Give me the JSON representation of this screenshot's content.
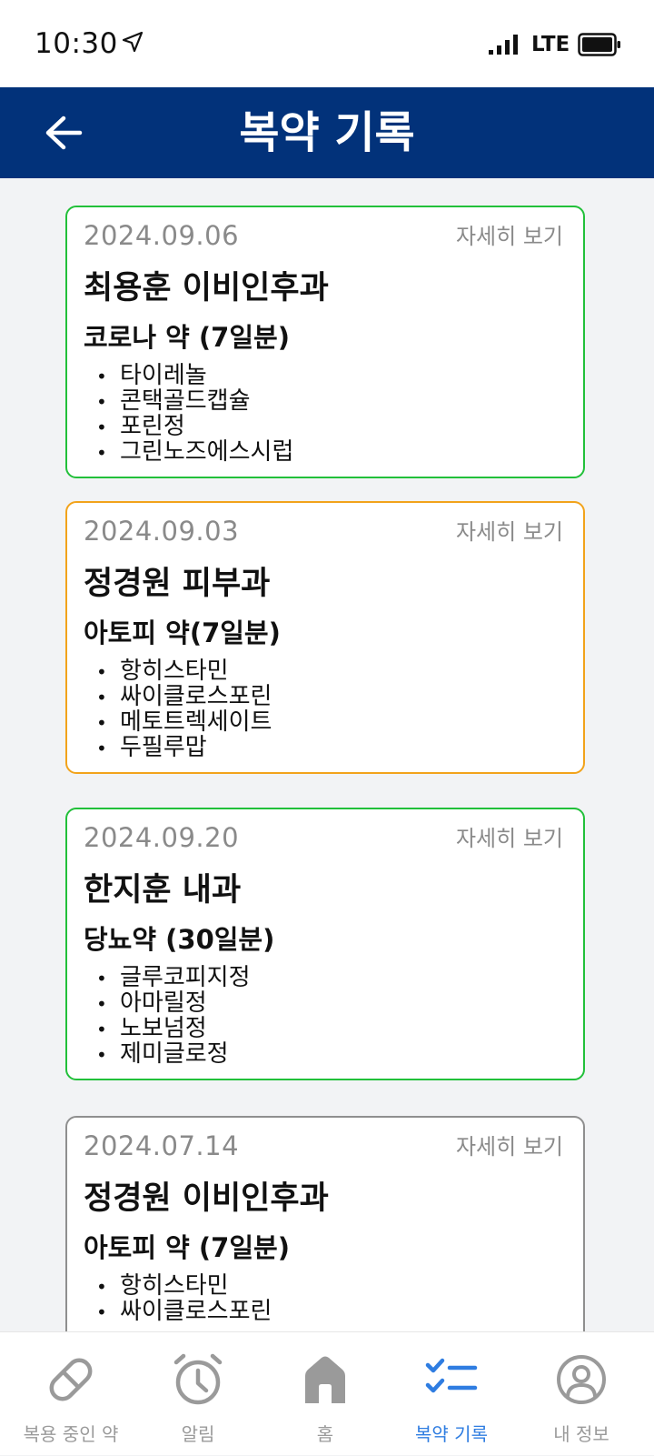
{
  "status_bar": {
    "time": "10:30",
    "network": "LTE"
  },
  "header": {
    "title": "복약 기록"
  },
  "records": [
    {
      "date": "2024.09.06",
      "detail_label": "자세히 보기",
      "clinic": "최용훈 이비인후과",
      "prescription": "코로나 약 (7일분)",
      "medicines": [
        "타이레놀",
        "콘택골드캡슐",
        "포린정",
        "그린노즈에스시럽"
      ],
      "border_color": "#22c03a"
    },
    {
      "date": "2024.09.03",
      "detail_label": "자세히 보기",
      "clinic": "정경원 피부과",
      "prescription": "아토피 약(7일분)",
      "medicines": [
        "항히스타민",
        "싸이클로스포린",
        "메토트렉세이트",
        "두필루맙"
      ],
      "border_color": "#f2a31b"
    },
    {
      "date": "2024.09.20",
      "detail_label": "자세히 보기",
      "clinic": "한지훈 내과",
      "prescription": "당뇨약 (30일분)",
      "medicines": [
        "글루코피지정",
        "아마릴정",
        "노보넘정",
        "제미글로정"
      ],
      "border_color": "#22c03a"
    },
    {
      "date": "2024.07.14",
      "detail_label": "자세히 보기",
      "clinic": "정경원 이비인후과",
      "prescription": "아토피 약 (7일분)",
      "medicines": [
        "항히스타민",
        "싸이클로스포린"
      ],
      "border_color": "#8f8f8f"
    }
  ],
  "bottom_nav": {
    "items": [
      {
        "label": "복용 중인 약",
        "icon": "pill-icon"
      },
      {
        "label": "알림",
        "icon": "alarm-clock-icon"
      },
      {
        "label": "홈",
        "icon": "home-icon"
      },
      {
        "label": "복약 기록",
        "icon": "checklist-icon"
      },
      {
        "label": "내 정보",
        "icon": "profile-icon"
      }
    ],
    "active_index": 3,
    "active_color": "#2f7de1",
    "inactive_color": "#9a9a9a"
  },
  "colors": {
    "header_bg": "#02327a",
    "page_bg": "#f2f3f5"
  }
}
